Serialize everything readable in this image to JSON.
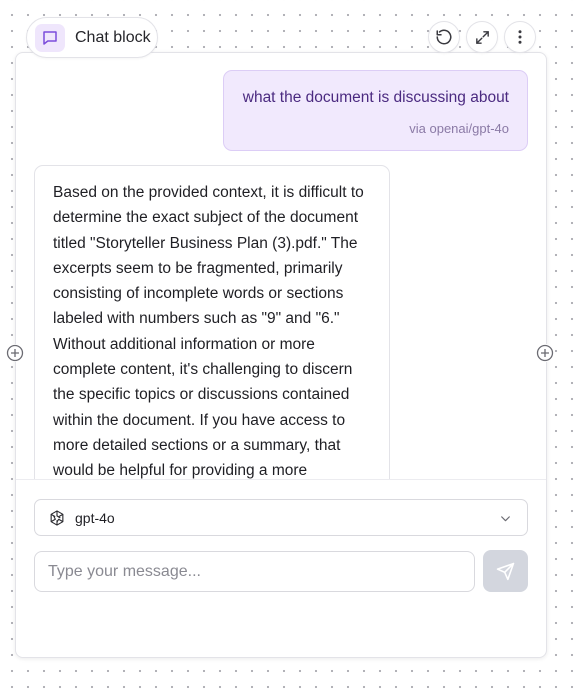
{
  "block": {
    "title": "Chat block",
    "icons": {
      "title": "chat-bubble-icon",
      "refresh": "refresh-icon",
      "expand": "expand-icon",
      "more": "more-vertical-icon"
    }
  },
  "messages": {
    "user": {
      "text": "what the document is discussing about",
      "via": "via openai/gpt-4o"
    },
    "assistant": {
      "lines": [
        "Based on the provided context, it is difficult to",
        "determine the exact subject of the document",
        "titled \"Storyteller Business Plan (3).pdf.\" The",
        "excerpts seem to be fragmented, primarily",
        "consisting of incomplete words or sections",
        "labeled with numbers such as \"9\" and \"6.\"",
        "Without additional information or more",
        "complete content, it's challenging to discern",
        "the specific topics or discussions contained",
        "within the document. If you have access to",
        "more detailed sections or a summary, that",
        "would be helpful for providing a more"
      ]
    }
  },
  "composer": {
    "model": "gpt-4o",
    "model_icon": "openai-logo-icon",
    "placeholder": "Type your message...",
    "send_icon": "send-icon"
  },
  "colors": {
    "accent": "#7c4ddb",
    "user_bubble": "#f1e9fd",
    "send_disabled": "#d3d6de"
  }
}
